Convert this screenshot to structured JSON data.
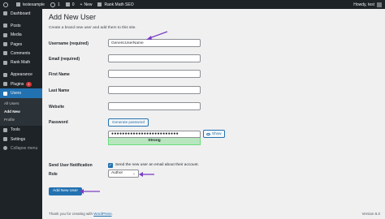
{
  "adminbar": {
    "site_name": "testexample",
    "updates_count": "1",
    "comments_count": "0",
    "new_label": "New",
    "rankmath_label": "Rank Math SEO",
    "howdy": "Howdy, test"
  },
  "sidebar": {
    "items": [
      {
        "label": "Dashboard",
        "icon": "dashboard-icon"
      },
      {
        "label": "Posts",
        "icon": "pin-icon"
      },
      {
        "label": "Media",
        "icon": "media-icon"
      },
      {
        "label": "Pages",
        "icon": "pages-icon"
      },
      {
        "label": "Comments",
        "icon": "comment-icon"
      },
      {
        "label": "Rank Math",
        "icon": "rankmath-icon"
      },
      {
        "label": "Appearance",
        "icon": "brush-icon"
      },
      {
        "label": "Plugins",
        "icon": "plugin-icon",
        "badge": "1"
      },
      {
        "label": "Users",
        "icon": "users-icon"
      },
      {
        "label": "Tools",
        "icon": "wrench-icon"
      },
      {
        "label": "Settings",
        "icon": "settings-icon"
      },
      {
        "label": "Collapse menu",
        "icon": "collapse-icon"
      }
    ],
    "users_submenu": [
      "All Users",
      "Add New",
      "Profile"
    ]
  },
  "page": {
    "title": "Add New User",
    "intro": "Create a brand new user and add them to this site."
  },
  "form": {
    "username_label": "Username (required)",
    "username_value": "GenericUserName",
    "email_label": "Email (required)",
    "first_name_label": "First Name",
    "last_name_label": "Last Name",
    "website_label": "Website",
    "password_label": "Password",
    "generate_password_label": "Generate password",
    "password_value": "●●●●●●●●●●●●●●●●●●●●●●●●●",
    "strength_label": "Strong",
    "show_label": "Show",
    "notification_label": "Send User Notification",
    "notification_text": "Send the new user an email about their account.",
    "role_label": "Role",
    "role_value": "Author",
    "submit_label": "Add New User"
  },
  "footer": {
    "text_prefix": "Thank you for creating with ",
    "link_text": "WordPress",
    "text_suffix": ".",
    "version": "Version 6.0"
  },
  "colors": {
    "accent": "#2271b1",
    "adminbar": "#1d2327",
    "strength_bg": "#b8e6bf",
    "annotation_arrow": "#7b3fc4"
  }
}
